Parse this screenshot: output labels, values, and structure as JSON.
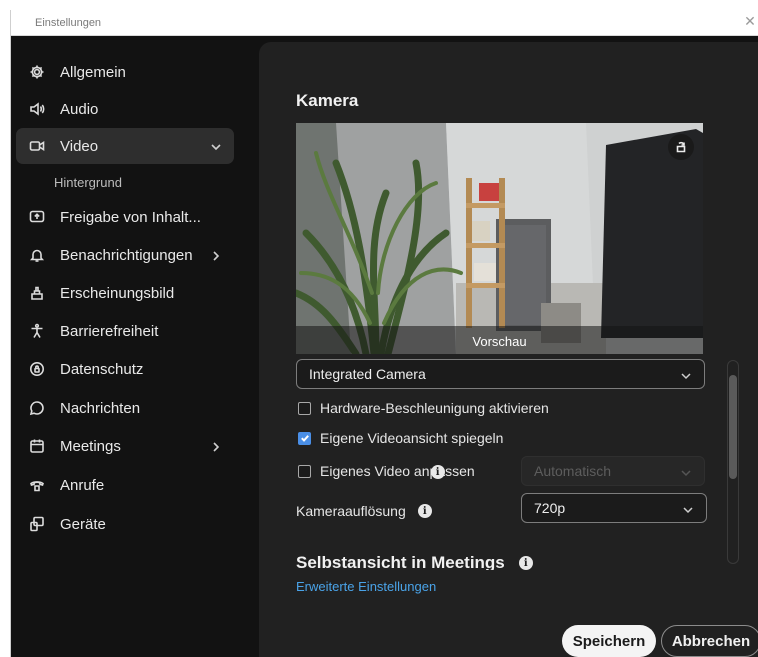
{
  "window": {
    "title": "Einstellungen",
    "close_glyph": "✕"
  },
  "sidebar": {
    "items": [
      {
        "label": "Allgemein",
        "icon": "gear-icon"
      },
      {
        "label": "Audio",
        "icon": "speaker-icon"
      },
      {
        "label": "Video",
        "icon": "video-camera-icon",
        "active": true,
        "expanded": true
      },
      {
        "label": "Freigabe von Inhalt...",
        "icon": "share-screen-icon"
      },
      {
        "label": "Benachrichtigungen",
        "icon": "bell-icon",
        "has_submenu": true
      },
      {
        "label": "Erscheinungsbild",
        "icon": "appearance-icon"
      },
      {
        "label": "Barrierefreiheit",
        "icon": "accessibility-icon"
      },
      {
        "label": "Datenschutz",
        "icon": "privacy-icon"
      },
      {
        "label": "Nachrichten",
        "icon": "chat-bubble-icon"
      },
      {
        "label": "Meetings",
        "icon": "calendar-icon",
        "has_submenu": true
      },
      {
        "label": "Anrufe",
        "icon": "phone-icon"
      },
      {
        "label": "Geräte",
        "icon": "devices-icon"
      }
    ],
    "sub_item": "Hintergrund"
  },
  "camera": {
    "title": "Kamera",
    "preview_label": "Vorschau",
    "device_select": "Integrated Camera",
    "options": {
      "hardware_accel": {
        "label": "Hardware-Beschleunigung aktivieren",
        "checked": false
      },
      "mirror": {
        "label": "Eigene Videoansicht spiegeln",
        "checked": true
      },
      "adjust": {
        "label": "Eigenes Video anpassen",
        "checked": false
      }
    },
    "adjust_select": "Automatisch",
    "resolution_label": "Kameraauflösung",
    "resolution_value": "720p"
  },
  "self_view": {
    "title": "Selbstansicht in Meetings"
  },
  "advanced_link": "Erweiterte Einstellungen",
  "buttons": {
    "save": "Speichern",
    "cancel": "Abbrechen"
  },
  "colors": {
    "accent": "#4a8fe7",
    "link": "#4aa3e8",
    "background": "#121212",
    "panel": "#212121"
  }
}
